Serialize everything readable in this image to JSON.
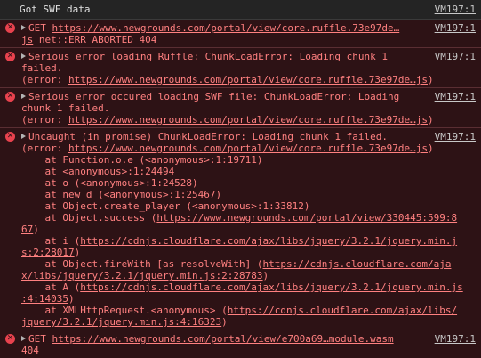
{
  "log_row": {
    "text": "Got SWF data",
    "source": "VM197:1"
  },
  "entries": [
    {
      "source": "VM197:1",
      "lines": [
        [
          "GET ",
          {
            "link": "https://www.newgrounds.com/portal/view/core.ruffle.73e97de…"
          }
        ],
        [
          {
            "link": "js"
          },
          " net::ERR_ABORTED 404"
        ]
      ]
    },
    {
      "source": "VM197:1",
      "lines": [
        [
          "Serious error loading Ruffle: ChunkLoadError: Loading chunk 1"
        ],
        [
          "failed."
        ],
        [
          "(error: ",
          {
            "link": "https://www.newgrounds.com/portal/view/core.ruffle.73e97de…js"
          },
          ")"
        ]
      ]
    },
    {
      "source": "VM197:1",
      "lines": [
        [
          "Serious error occured loading SWF file: ChunkLoadError: Loading"
        ],
        [
          "chunk 1 failed."
        ],
        [
          "(error: ",
          {
            "link": "https://www.newgrounds.com/portal/view/core.ruffle.73e97de…js"
          },
          ")"
        ]
      ]
    },
    {
      "source": "VM197:1",
      "lines": [
        [
          "Uncaught (in promise) ChunkLoadError: Loading chunk 1 failed."
        ],
        [
          "(error: ",
          {
            "link": "https://www.newgrounds.com/portal/view/core.ruffle.73e97de…js"
          },
          ")"
        ],
        [
          "    at Function.o.e (<anonymous>:1:19711)"
        ],
        [
          "    at <anonymous>:1:24494"
        ],
        [
          "    at o (<anonymous>:1:24528)"
        ],
        [
          "    at new d (<anonymous>:1:25467)"
        ],
        [
          "    at Object.create_player (<anonymous>:1:33812)"
        ],
        [
          "    at Object.success (",
          {
            "link": "https://www.newgrounds.com/portal/view/330445:599:8"
          }
        ],
        [
          {
            "link": "67"
          },
          ")"
        ],
        [
          "    at i (",
          {
            "link": "https://cdnjs.cloudflare.com/ajax/libs/jquery/3.2.1/jquery.min.j"
          }
        ],
        [
          {
            "link": "s:2:28017"
          },
          ")"
        ],
        [
          "    at Object.fireWith [as resolveWith] (",
          {
            "link": "https://cdnjs.cloudflare.com/aja"
          }
        ],
        [
          {
            "link": "x/libs/jquery/3.2.1/jquery.min.js:2:28783"
          },
          ")"
        ],
        [
          "    at A (",
          {
            "link": "https://cdnjs.cloudflare.com/ajax/libs/jquery/3.2.1/jquery.min.js"
          }
        ],
        [
          {
            "link": ":4:14035"
          },
          ")"
        ],
        [
          "    at XMLHttpRequest.<anonymous> (",
          {
            "link": "https://cdnjs.cloudflare.com/ajax/libs/"
          }
        ],
        [
          {
            "link": "jquery/3.2.1/jquery.min.js:4:16323"
          },
          ")"
        ]
      ]
    },
    {
      "source": "VM197:1",
      "lines": [
        [
          "GET ",
          {
            "link": "https://www.newgrounds.com/portal/view/e700a69…module.wasm"
          }
        ],
        [
          "404"
        ]
      ]
    }
  ],
  "icons": {
    "error": "error-circle-icon",
    "expand": "disclosure-triangle-icon"
  },
  "colors": {
    "error_bg": "#2d1215",
    "error_text": "#ff8080",
    "error_icon": "#e8424e",
    "log_bg": "#242424"
  }
}
